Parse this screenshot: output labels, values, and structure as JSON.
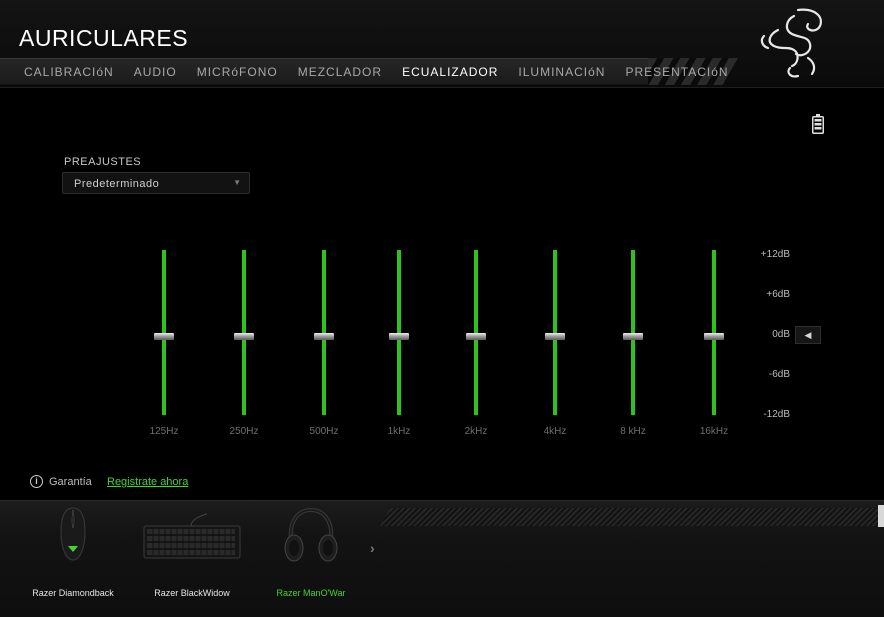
{
  "app": {
    "title": "AURICULARES"
  },
  "tabs": [
    {
      "label": "CALIBRACIóN",
      "active": false
    },
    {
      "label": "AUDIO",
      "active": false
    },
    {
      "label": "MICRóFONO",
      "active": false
    },
    {
      "label": "MEZCLADOR",
      "active": false
    },
    {
      "label": "ECUALIZADOR",
      "active": true
    },
    {
      "label": "ILUMINACIóN",
      "active": false
    },
    {
      "label": "PRESENTACIóN",
      "active": false
    }
  ],
  "icons": {
    "logo": "razer-snake-logo",
    "battery": "battery-icon",
    "info": "info-icon",
    "next": "chevron-right-icon"
  },
  "colors": {
    "accent": "#44d62c",
    "slider": "#2ec21c",
    "background": "#000000"
  },
  "presets": {
    "label": "PREAJUSTES",
    "value": "Predeterminado",
    "arrow": "▼"
  },
  "equalizer": {
    "bands": [
      {
        "freq": "125Hz",
        "gain_db": 0
      },
      {
        "freq": "250Hz",
        "gain_db": 0
      },
      {
        "freq": "500Hz",
        "gain_db": 0
      },
      {
        "freq": "1kHz",
        "gain_db": 0
      },
      {
        "freq": "2kHz",
        "gain_db": 0
      },
      {
        "freq": "4kHz",
        "gain_db": 0
      },
      {
        "freq": "8 kHz",
        "gain_db": 0
      },
      {
        "freq": "16kHz",
        "gain_db": 0
      }
    ],
    "scale": [
      "+12dB",
      "+6dB",
      "0dB",
      "-6dB",
      "-12dB"
    ],
    "range_db": [
      -12,
      12
    ],
    "marker": "◀"
  },
  "warranty": {
    "info_glyph": "i",
    "label": "Garantía",
    "link": "Registrate ahora"
  },
  "devices": [
    {
      "name": "Razer Diamondback",
      "icon": "mouse-icon",
      "active": false
    },
    {
      "name": "Razer BlackWidow",
      "icon": "keyboard-icon",
      "active": false
    },
    {
      "name": "Razer ManO'War",
      "icon": "headset-icon",
      "active": true
    }
  ],
  "tray": {
    "next_glyph": "›"
  }
}
